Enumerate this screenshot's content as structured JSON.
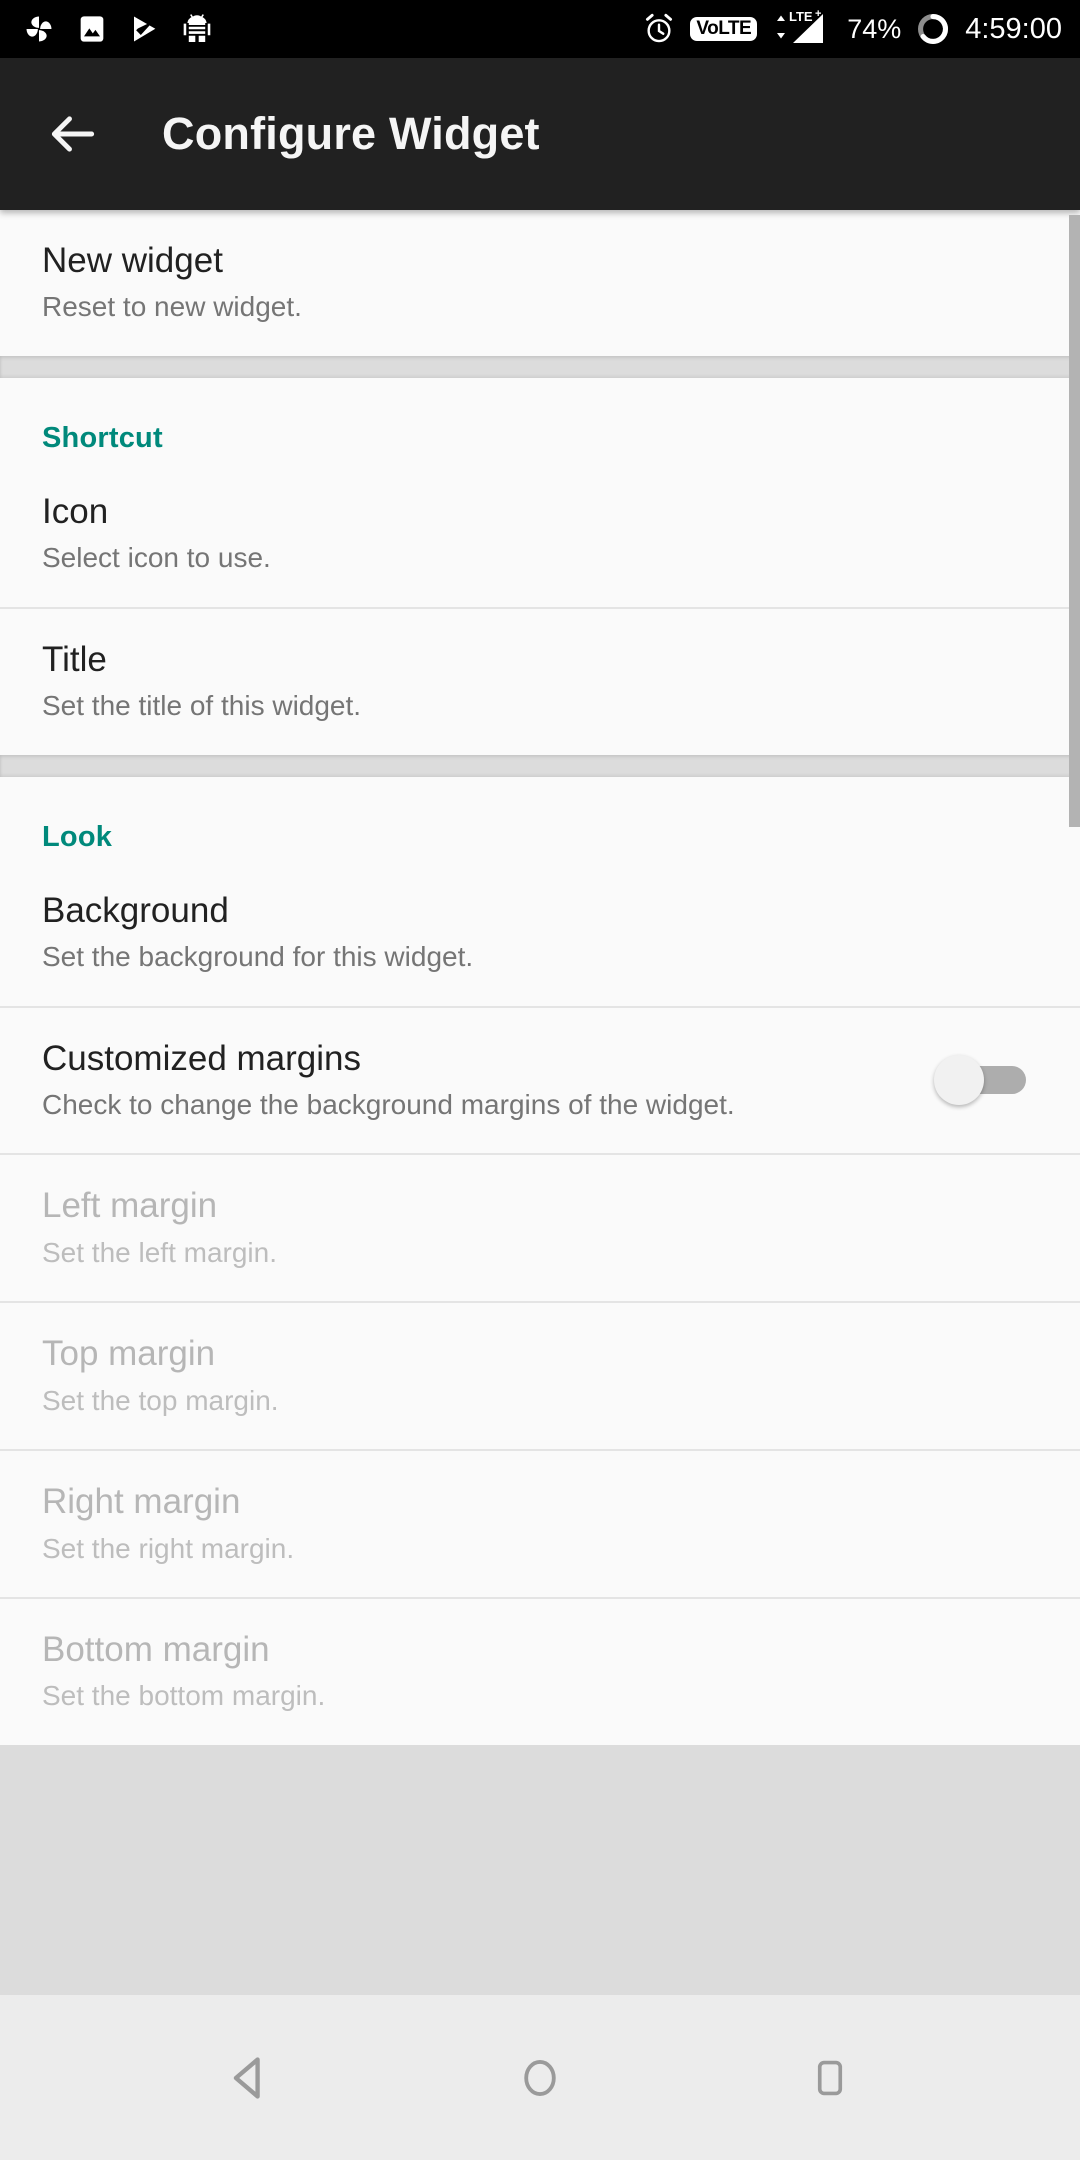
{
  "status_bar": {
    "left_icons": [
      "photos-pinwheel-icon",
      "gallery-image-icon",
      "check-badge-icon",
      "android-bug-icon"
    ],
    "alarm_icon": "alarm-icon",
    "volte_label": "VoLTE",
    "network_label": "LTE+",
    "signal_icon": "signal-bars-icon",
    "battery_percent": "74%",
    "battery_ring_icon": "battery-ring-icon",
    "clock": "4:59:00"
  },
  "appbar": {
    "back_icon": "back-arrow-icon",
    "title": "Configure Widget"
  },
  "sections": [
    {
      "header": null,
      "rows": [
        {
          "title": "New widget",
          "sub": "Reset to new widget.",
          "disabled": false,
          "control": null
        }
      ]
    },
    {
      "header": "Shortcut",
      "rows": [
        {
          "title": "Icon",
          "sub": "Select icon to use.",
          "disabled": false,
          "control": null
        },
        {
          "title": "Title",
          "sub": "Set the title of this widget.",
          "disabled": false,
          "control": null
        }
      ]
    },
    {
      "header": "Look",
      "rows": [
        {
          "title": "Background",
          "sub": "Set the background for this widget.",
          "disabled": false,
          "control": null
        },
        {
          "title": "Customized margins",
          "sub": "Check to change the background margins of the widget.",
          "disabled": false,
          "control": "switch-off"
        },
        {
          "title": "Left margin",
          "sub": "Set the left margin.",
          "disabled": true,
          "control": null
        },
        {
          "title": "Top margin",
          "sub": "Set the top margin.",
          "disabled": true,
          "control": null
        },
        {
          "title": "Right margin",
          "sub": "Set the right margin.",
          "disabled": true,
          "control": null
        },
        {
          "title": "Bottom margin",
          "sub": "Set the bottom margin.",
          "disabled": true,
          "control": null
        }
      ]
    }
  ],
  "nav_bar": {
    "back_icon": "nav-back-triangle-icon",
    "home_icon": "nav-home-circle-icon",
    "recents_icon": "nav-recents-square-icon"
  },
  "colors": {
    "accent": "#00897B",
    "appbar_bg": "#212121",
    "card_bg": "#FAFAFA",
    "gap_bg": "#DCDCDC",
    "navbar_bg": "#ECECEC"
  }
}
